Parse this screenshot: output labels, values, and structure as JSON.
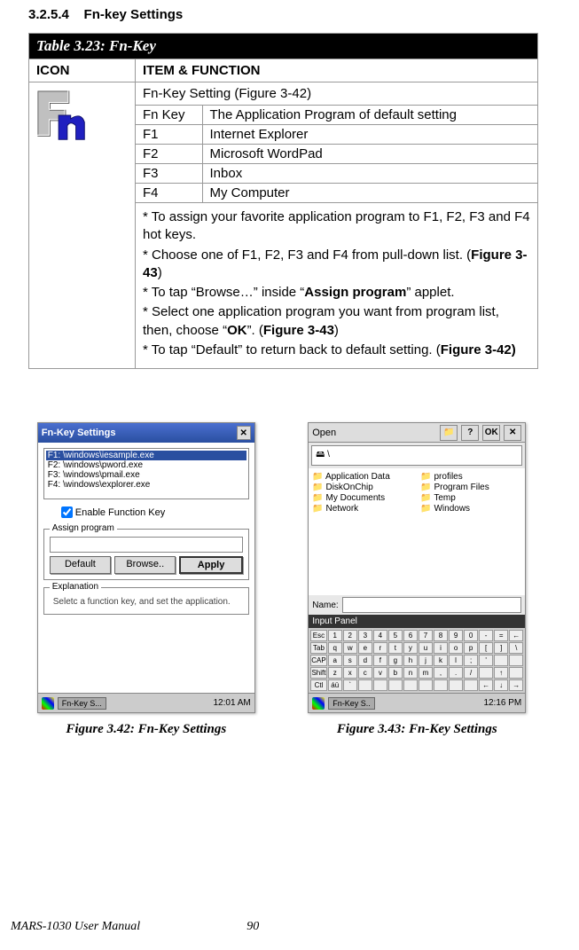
{
  "section": {
    "number": "3.2.5.4",
    "title": "Fn-key Settings"
  },
  "table": {
    "title": "Table 3.23: Fn-Key",
    "headers": {
      "icon": "ICON",
      "item": "ITEM & FUNCTION"
    },
    "fnTitle": "Fn-Key Setting (Figure 3-42)",
    "rows": [
      {
        "key": "Fn Key",
        "desc": "The Application Program of default setting"
      },
      {
        "key": "F1",
        "desc": "Internet Explorer"
      },
      {
        "key": "F2",
        "desc": "Microsoft WordPad"
      },
      {
        "key": "F3",
        "desc": "Inbox"
      },
      {
        "key": "F4",
        "desc": "My Computer"
      }
    ],
    "instructions": [
      "*  To assign your favorite application program to F1, F2, F3 and F4 hot keys.",
      "*  Choose one of F1, F2, F3 and F4 from pull-down list. (<b>Figure 3-43</b>)",
      "*  To tap “Browse…” inside “<b>Assign program</b>” applet.",
      "*  Select one application program you want from program list, then, choose “<b>OK</b>”. (<b>Figure 3-43</b>)",
      "*  To tap “Default” to return back to default setting. (<b>Figure 3-42)</b>"
    ]
  },
  "figure42": {
    "caption": "Figure 3.42: Fn-Key Settings",
    "window": {
      "title": "Fn-Key Settings",
      "list": [
        "F1:  \\windows\\iesample.exe",
        "F2:  \\windows\\pword.exe",
        "F3:  \\windows\\pmail.exe",
        "F4:  \\windows\\explorer.exe"
      ],
      "check": "Enable Function Key",
      "group1": {
        "title": "Assign program",
        "buttons": {
          "def": "Default",
          "browse": "Browse..",
          "apply": "Apply"
        }
      },
      "group2": {
        "title": "Explanation",
        "text": "Seletc a function key, and set the application."
      },
      "taskbar": {
        "app": "Fn-Key S...",
        "time": "12:01 AM"
      }
    }
  },
  "figure43": {
    "caption": "Figure 3.43: Fn-Key Settings",
    "open": {
      "title": "Open",
      "ok": "OK",
      "help": "?",
      "path": "\\",
      "files": [
        "Application Data",
        "DiskOnChip",
        "My Documents",
        "Network",
        "profiles",
        "Program Files",
        "Temp",
        "Windows"
      ],
      "nameLabel": "Name:",
      "inputPanel": "Input Panel",
      "kbRows": [
        [
          "Esc",
          "1",
          "2",
          "3",
          "4",
          "5",
          "6",
          "7",
          "8",
          "9",
          "0",
          "-",
          "=",
          "←"
        ],
        [
          "Tab",
          "q",
          "w",
          "e",
          "r",
          "t",
          "y",
          "u",
          "i",
          "o",
          "p",
          "[",
          "]",
          "\\"
        ],
        [
          "CAP",
          "a",
          "s",
          "d",
          "f",
          "g",
          "h",
          "j",
          "k",
          "l",
          ";",
          "'",
          "",
          ""
        ],
        [
          "Shift",
          "z",
          "x",
          "c",
          "v",
          "b",
          "n",
          "m",
          ",",
          ".",
          "/",
          "",
          "↑",
          ""
        ],
        [
          "Ctl",
          "áü",
          "`",
          "",
          "",
          "",
          "",
          "",
          "",
          "",
          "",
          "←",
          "↓",
          "→"
        ]
      ],
      "taskbar": {
        "app": "Fn-Key S..",
        "time": "12:16 PM"
      }
    }
  },
  "footer": {
    "manual": "MARS-1030 User Manual",
    "page": "90"
  }
}
